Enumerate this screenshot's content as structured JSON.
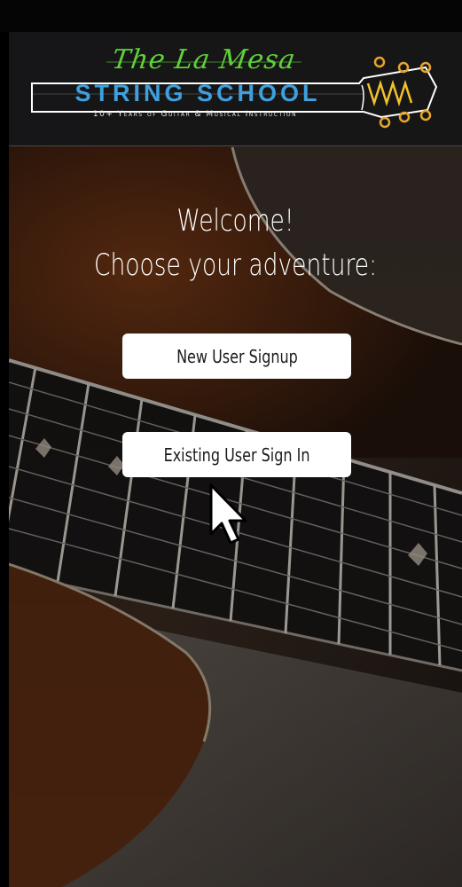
{
  "logo": {
    "script_title": "The La Mesa",
    "main_title": "STRING SCHOOL",
    "tagline": "10+ Years of Guitar & Musical Instruction",
    "icon": "guitar-headstock-icon"
  },
  "welcome": {
    "line1": "Welcome!",
    "line2": "Choose your adventure:"
  },
  "buttons": {
    "signup": "New User Signup",
    "signin": "Existing User Sign In"
  },
  "colors": {
    "script_green": "#5fd23a",
    "title_blue": "#3ea0df",
    "headstock_gold": "#e8a62a",
    "wave_yellow": "#f2c12e",
    "button_bg": "#ffffff"
  },
  "pointer": "arrow-cursor-icon"
}
